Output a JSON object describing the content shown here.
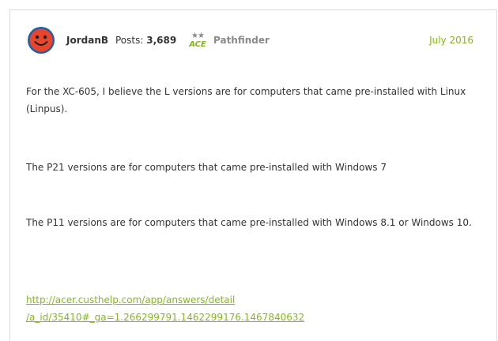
{
  "post": {
    "username": "JordanB",
    "posts_label": "Posts:",
    "posts_count": "3,689",
    "rank_badge": "ACE",
    "rank_stars": "★★",
    "rank_name": "Pathfinder",
    "date": "July 2016",
    "paragraphs": [
      "For the XC-605, I believe the L versions are for computers that came pre-installed with Linux (Linpus).",
      "The P21 versions are for computers that came pre-installed with Windows 7",
      "The P11 versions are for computers that came pre-installed with Windows 8.1 or Windows 10."
    ],
    "link_line1": "http://acer.custhelp.com/app/answers/detail",
    "link_line2": "/a_id/35410#_ga=1.266299791.1462299176.1467840632"
  },
  "colors": {
    "accent": "#83b81a",
    "avatar_face": "#e8462c",
    "avatar_ring": "#1e5fa8"
  }
}
